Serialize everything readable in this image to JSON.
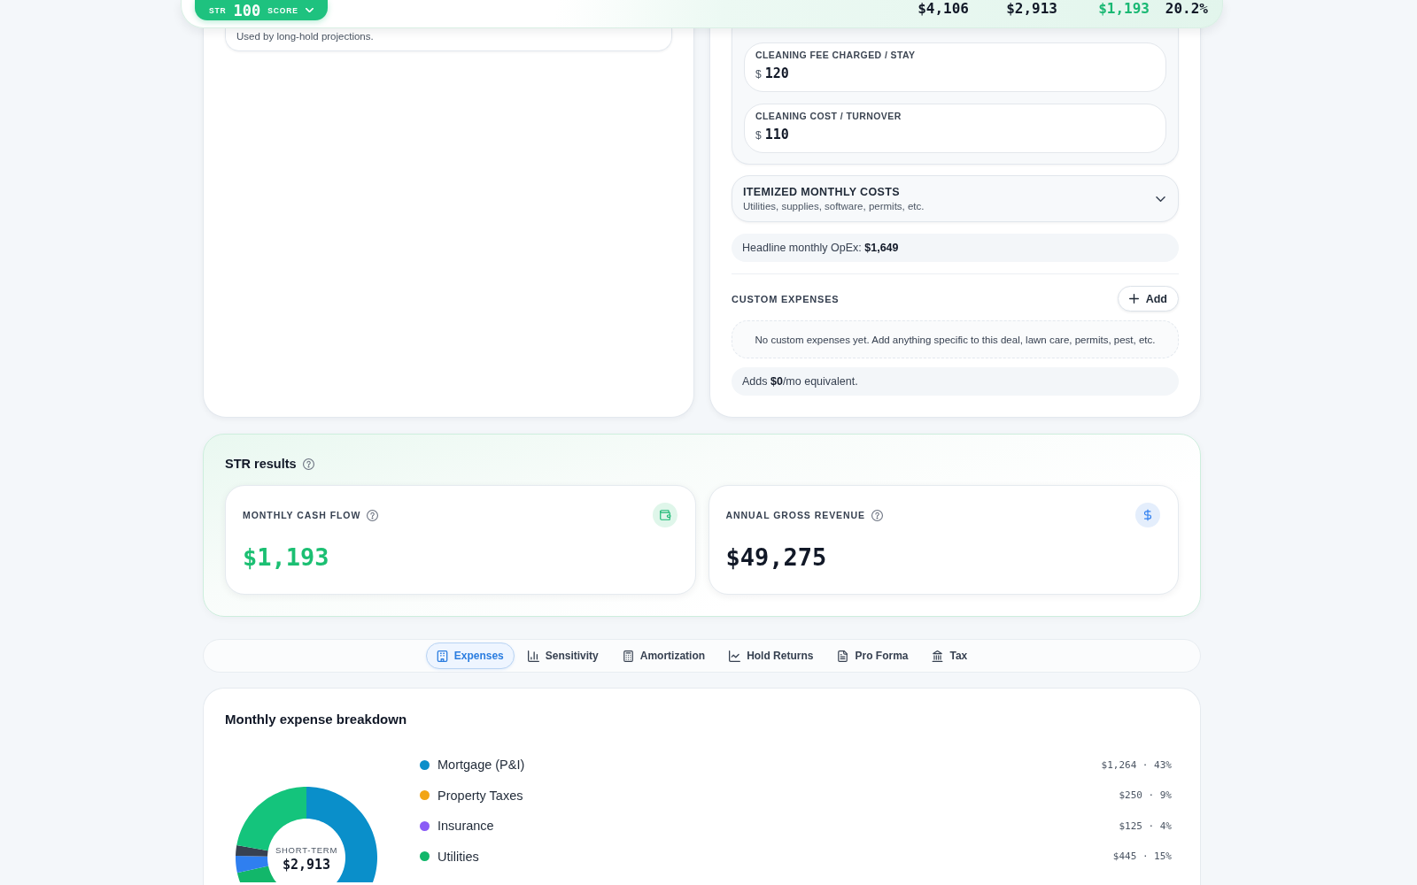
{
  "header": {
    "score_badge": {
      "prefix": "STR",
      "score": "100",
      "suffix": "SCORE"
    },
    "metrics": [
      {
        "value": "$4,106",
        "positive": false
      },
      {
        "value": "$2,913",
        "positive": false
      },
      {
        "value": "$1,193",
        "positive": true
      },
      {
        "value": "20.2%",
        "positive": false
      }
    ]
  },
  "left_panel": {
    "field_hint": "Used by long-hold projections."
  },
  "right_panel": {
    "cleaning_fields": [
      {
        "label": "CLEANING FEE CHARGED / STAY",
        "prefix": "$",
        "value": "120"
      },
      {
        "label": "CLEANING COST / TURNOVER",
        "prefix": "$",
        "value": "110"
      }
    ],
    "itemized": {
      "title": "ITEMIZED MONTHLY COSTS",
      "subtitle": "Utilities, supplies, software, permits, etc.",
      "expanded": false
    },
    "headline": "Headline monthly OpEx: **$1,649**",
    "custom_expenses": {
      "title": "CUSTOM EXPENSES",
      "add_button": "Add",
      "empty_message": "No custom expenses yet. Add anything specific to this deal, lawn care, permits, pest, etc.",
      "total_note": "Adds **$0**/mo equivalent."
    }
  },
  "results": {
    "title": "STR results",
    "cards": [
      {
        "label": "MONTHLY CASH FLOW",
        "value": "$1,193",
        "positive": true
      },
      {
        "label": "ANNUAL GROSS REVENUE",
        "value": "$49,275",
        "positive": false
      }
    ]
  },
  "tabs": [
    {
      "label": "Expenses",
      "selected": true
    },
    {
      "label": "Sensitivity",
      "selected": false
    },
    {
      "label": "Amortization",
      "selected": false
    },
    {
      "label": "Hold Returns",
      "selected": false
    },
    {
      "label": "Pro Forma",
      "selected": false
    },
    {
      "label": "Tax",
      "selected": false
    }
  ],
  "breakdown": {
    "title": "Monthly expense breakdown",
    "center_label": "SHORT-TERM",
    "center_value": "$2,913",
    "legend": [
      {
        "label": "Mortgage (P&I)",
        "value": "$1,264 · 43%",
        "color": "#0a8fca"
      },
      {
        "label": "Property Taxes",
        "value": "$250 · 9%",
        "color": "#f2a516"
      },
      {
        "label": "Insurance",
        "value": "$125 · 4%",
        "color": "#8b5cf6"
      },
      {
        "label": "Utilities",
        "value": "$445 · 15%",
        "color": "#12b76a"
      }
    ]
  }
}
